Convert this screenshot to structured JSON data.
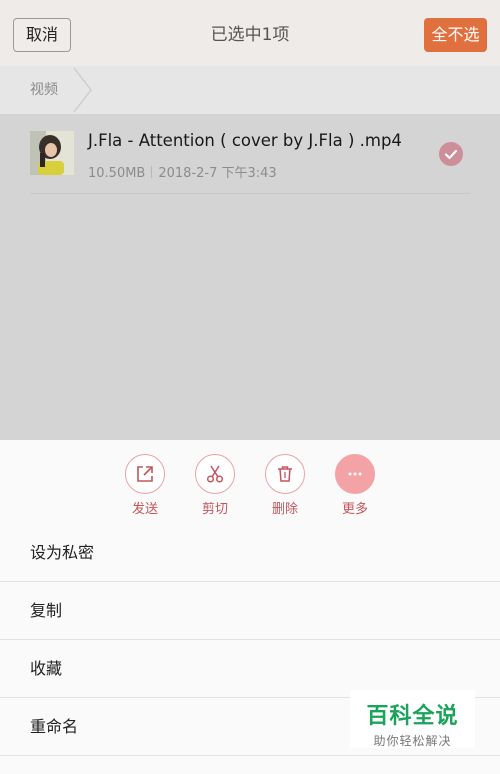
{
  "header": {
    "cancel_label": "取消",
    "title": "已选中1项",
    "deselect_all_label": "全不选"
  },
  "breadcrumb": {
    "label": "视频"
  },
  "files": [
    {
      "name": "J.Fla - Attention ( cover by J.Fla ) .mp4",
      "size": "10.50MB",
      "date": "2018-2-7 下午3:43",
      "selected": true
    }
  ],
  "actions": [
    {
      "label": "发送",
      "icon": "share-icon"
    },
    {
      "label": "剪切",
      "icon": "scissors-icon"
    },
    {
      "label": "删除",
      "icon": "trash-icon"
    },
    {
      "label": "更多",
      "icon": "more-icon"
    }
  ],
  "menu": [
    {
      "label": "设为私密"
    },
    {
      "label": "复制"
    },
    {
      "label": "收藏"
    },
    {
      "label": "重命名"
    }
  ],
  "watermark": {
    "title": "百科全说",
    "subtitle": "助你轻松解决"
  },
  "colors": {
    "accent": "#e0713f",
    "action_tint": "#c2565c",
    "watermark_green": "#1aa35a"
  }
}
